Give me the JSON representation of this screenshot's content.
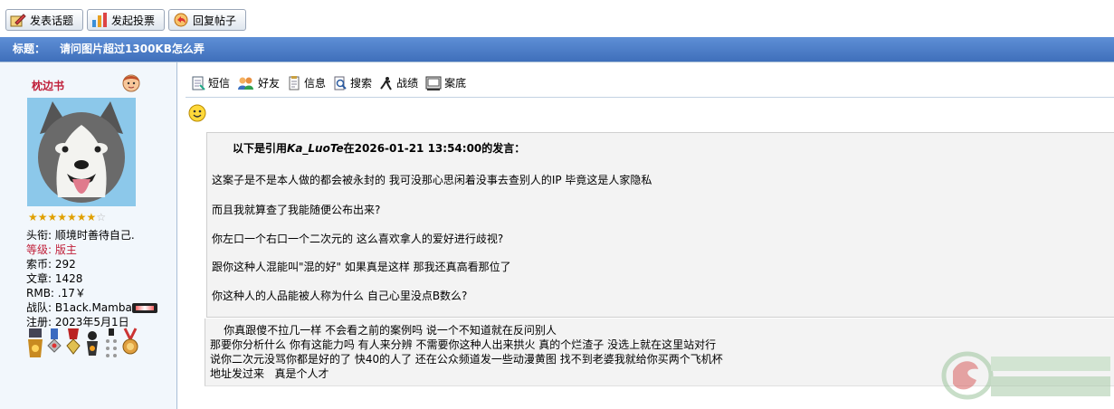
{
  "toolbar": {
    "buttons": [
      {
        "label": "发表话题",
        "icon": "pencil-icon"
      },
      {
        "label": "发起投票",
        "icon": "bar-chart-icon"
      },
      {
        "label": "回复帖子",
        "icon": "reply-icon"
      }
    ]
  },
  "thread": {
    "title_label": "标题：",
    "title": "请问图片超过1300KB怎么弄"
  },
  "author": {
    "name": "枕边书",
    "stars_filled": 7,
    "stars_total": 8,
    "fields": [
      {
        "label": "头衔:",
        "value": "顺境时善待自己."
      },
      {
        "label": "等级:",
        "value": "版主",
        "highlight": true
      },
      {
        "label": "索币:",
        "value": "292"
      },
      {
        "label": "文章:",
        "value": "1428"
      },
      {
        "label": "RMB:",
        "value": ".17￥"
      },
      {
        "label": "战队:",
        "value": "B1ack.Mamba",
        "team_logo": true
      },
      {
        "label": "注册:",
        "value": "2023年5月1日"
      }
    ],
    "medal_count": 6
  },
  "actions": [
    {
      "label": "短信",
      "icon": "message-icon"
    },
    {
      "label": "好友",
      "icon": "friends-icon"
    },
    {
      "label": "信息",
      "icon": "info-icon"
    },
    {
      "label": "搜索",
      "icon": "search-icon"
    },
    {
      "label": "战绩",
      "icon": "record-icon"
    },
    {
      "label": "案底",
      "icon": "case-file-icon"
    }
  ],
  "quote": {
    "prefix": "以下是引用",
    "quoted_user": "Ka_LuoTe",
    "middle": "在",
    "datetime": "2026-01-21 13:54:00",
    "suffix": "的发言：",
    "lines": [
      "这案子是不是本人做的都会被永封的 我可没那心思闲着没事去查别人的IP 毕竟这是人家隐私",
      "而且我就算查了我能随便公布出来?",
      "你左口一个右口一个二次元的 这么喜欢拿人的爱好进行歧视?",
      "跟你这种人混能叫\"混的好\" 如果真是这样  那我还真高看那位了",
      "你这种人的人品能被人称为什么 自己心里没点B数么?"
    ]
  },
  "reply": {
    "lines": [
      "    你真跟傻不拉几一样 不会看之前的案例吗 说一个不知道就在反问别人",
      "那要你分析什么 你有这能力吗 有人来分辨 不需要你这种人出来拱火 真的个烂渣子 没选上就在这里站对行",
      "说你二次元没骂你都是好的了 快40的人了 还在公众频道发一些动漫黄图 找不到老婆我就给你买两个飞机杯",
      "地址发过来   真是个人才"
    ]
  },
  "colors": {
    "title_bar": "#4a7cc6",
    "username": "#c0203a",
    "left_panel": "#f2f7fc",
    "quote_bg": "#f3f3f3"
  }
}
